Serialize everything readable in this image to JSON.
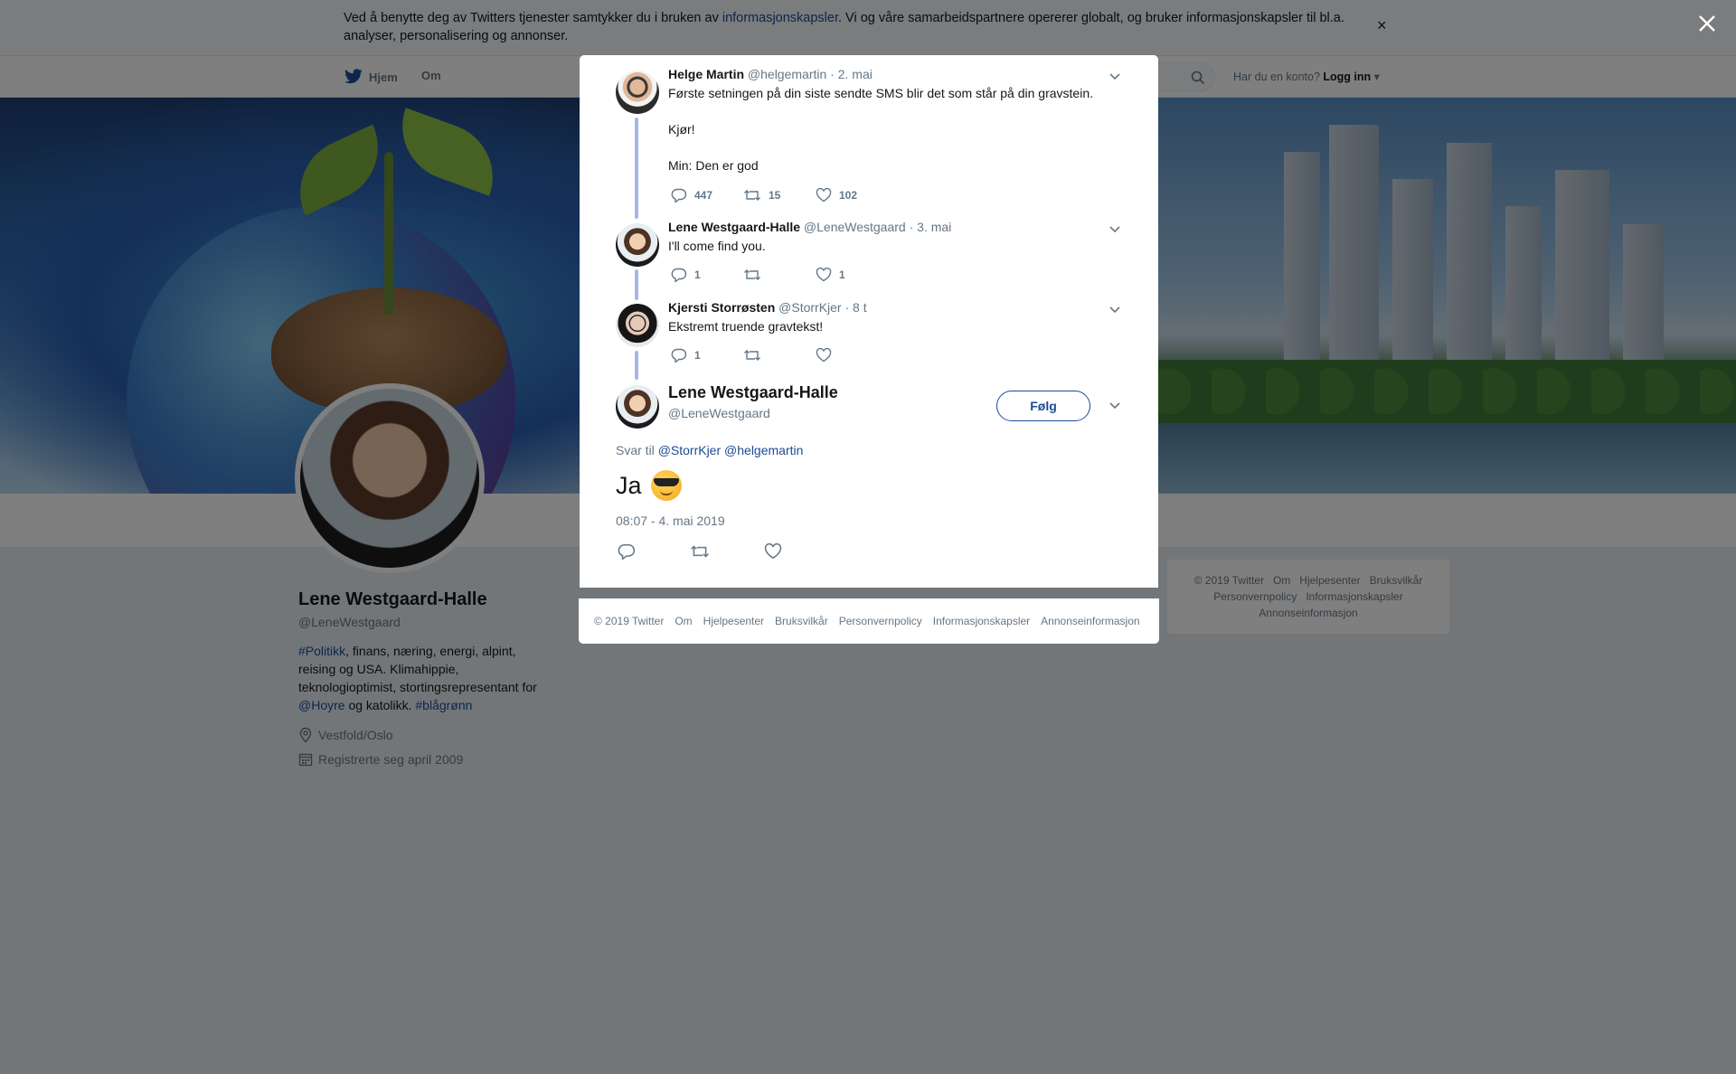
{
  "cookie": {
    "text_before": "Ved å benytte deg av Twitters tjenester samtykker du i bruken av ",
    "link": "informasjonskapsler",
    "text_after": ". Vi og våre samarbeidspartnere opererer globalt, og bruker informasjonskapsler til bl.a. analyser, personalisering og annonser.",
    "close": "×"
  },
  "nav": {
    "home": "Hjem",
    "about": "Om",
    "login_prompt": "Har du en konto?",
    "login": "Logg inn"
  },
  "profile": {
    "name": "Lene Westgaard-Halle",
    "handle": "@LeneWestgaard",
    "bio": {
      "tag1": "#Politikk",
      "text1": ", finans, næring, energi, alpint, reising og USA. Klimahippie, teknologioptimist, stortingsrepresentant for ",
      "mention": "@Hoyre",
      "text2": " og katolikk. ",
      "tag2": "#blågrønn"
    },
    "location": "Vestfold/Oslo",
    "joined": "Registrerte seg april 2009"
  },
  "side_footer": {
    "items": [
      "© 2019 Twitter",
      "Om",
      "Hjelpesenter",
      "Bruksvilkår",
      "Personvernpolicy",
      "Informasjonskapsler",
      "Annonseinformasjon"
    ]
  },
  "thread": [
    {
      "name": "Helge Martin",
      "handle": "@helgemartin",
      "date": "2. mai",
      "text": "Første setningen på din siste sendte SMS blir det som står på din gravstein.\n\nKjør!\n\nMin: Den er god",
      "replies": "447",
      "retweets": "15",
      "likes": "102"
    },
    {
      "name": "Lene Westgaard-Halle",
      "handle": "@LeneWestgaard",
      "date": "3. mai",
      "text": "I'll come find you.",
      "replies": "1",
      "retweets": "",
      "likes": "1"
    },
    {
      "name": "Kjersti Storrøsten",
      "handle": "@StorrKjer",
      "date": "8 t",
      "text": "Ekstremt truende gravtekst!",
      "replies": "1",
      "retweets": "",
      "likes": ""
    }
  ],
  "main_tweet": {
    "name": "Lene Westgaard-Halle",
    "handle": "@LeneWestgaard",
    "follow": "Følg",
    "reply_prefix": "Svar til",
    "reply_mention1": "@StorrKjer",
    "reply_mention2": "@helgemartin",
    "text": "Ja",
    "emoji": "smiling-face-with-sunglasses",
    "timestamp": "08:07 - 4. mai 2019"
  },
  "modal_footer": {
    "items": [
      "© 2019 Twitter",
      "Om",
      "Hjelpesenter",
      "Bruksvilkår",
      "Personvernpolicy",
      "Informasjonskapsler",
      "Annonseinformasjon"
    ]
  },
  "colors": {
    "link": "#1b4b94",
    "thread_line": "#a6b6eb",
    "muted": "#657786"
  }
}
